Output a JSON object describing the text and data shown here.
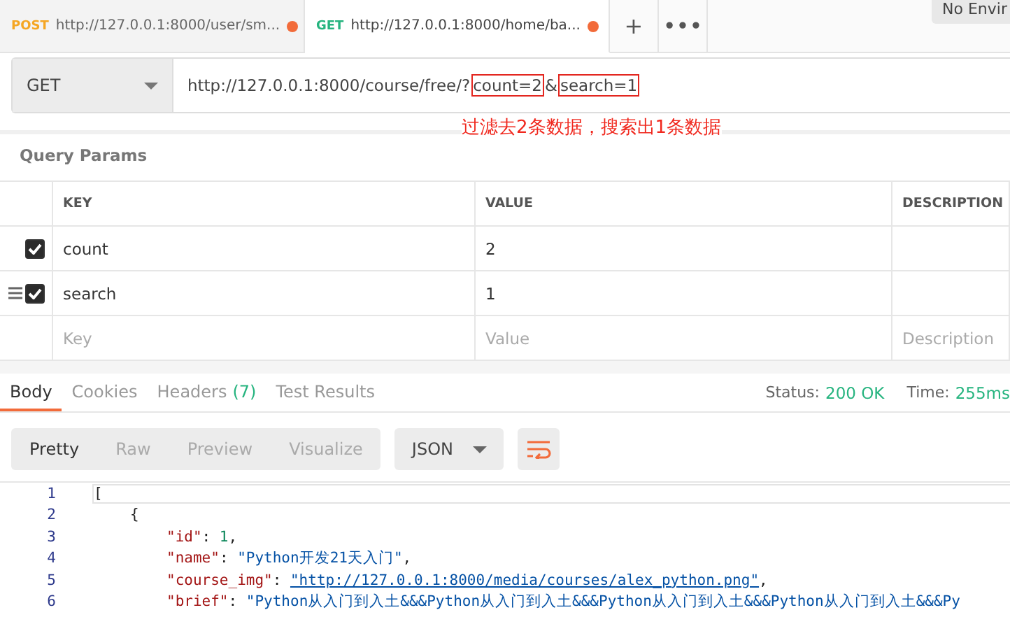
{
  "request_tabs": [
    {
      "method": "POST",
      "kind": "post",
      "label": "http://127.0.0.1:8000/user/sm...",
      "unsaved": true,
      "selected": false
    },
    {
      "method": "GET",
      "kind": "get",
      "label": "http://127.0.0.1:8000/home/ba...",
      "unsaved": true,
      "selected": true
    }
  ],
  "tab_actions": [
    "+",
    "•••"
  ],
  "environment": "No Envir",
  "request": {
    "method": "GET",
    "url_parts": [
      {
        "text": "http://127.0.0.1:8000/course/free/?",
        "boxed": false
      },
      {
        "text": "count=2",
        "boxed": true
      },
      {
        "text": "&",
        "boxed": false
      },
      {
        "text": "search=1",
        "boxed": true
      }
    ],
    "annotation": "过滤去2条数据，搜索出1条数据"
  },
  "query_params": {
    "title": "Query Params",
    "columns": [
      "KEY",
      "VALUE",
      "DESCRIPTION"
    ],
    "rows": [
      {
        "key": "count",
        "value": "2",
        "checked": true,
        "drag_handle": false
      },
      {
        "key": "search",
        "value": "1",
        "checked": true,
        "drag_handle": true
      }
    ],
    "new_row": [
      {
        "placeholder": "Key"
      },
      {
        "placeholder": "Value"
      },
      {
        "placeholder": "Description"
      }
    ]
  },
  "response": {
    "tabs": [
      {
        "label": "Body",
        "selected": true
      },
      {
        "label": "Cookies",
        "selected": false
      },
      {
        "label": "Headers",
        "count": "(7)",
        "selected": false
      },
      {
        "label": "Test Results",
        "selected": false
      }
    ],
    "status_label": "Status:",
    "status": "200 OK",
    "time_label": "Time:",
    "time": "255ms",
    "view_modes": [
      {
        "label": "Pretty",
        "selected": true
      },
      {
        "label": "Raw",
        "selected": false
      },
      {
        "label": "Preview",
        "selected": false
      },
      {
        "label": "Visualize",
        "selected": false
      }
    ],
    "format": "JSON",
    "lines": [
      {
        "number": "1",
        "current": true,
        "tokens": [
          {
            "kind": "punct",
            "text": "["
          }
        ],
        "children": [
          {
            "number": "2",
            "current": false,
            "tokens": [
              {
                "kind": "punct",
                "text": "{"
              }
            ],
            "children": [
              {
                "number": "3",
                "current": false,
                "tokens": [
                  {
                    "kind": "key",
                    "text": "\"id\""
                  },
                  {
                    "kind": "punct",
                    "text": ":"
                  },
                  {
                    "kind": "number",
                    "text": "1"
                  },
                  {
                    "kind": "punct",
                    "text": ","
                  }
                ]
              },
              {
                "number": "4",
                "current": false,
                "tokens": [
                  {
                    "kind": "key",
                    "text": "\"name\""
                  },
                  {
                    "kind": "punct",
                    "text": ":"
                  },
                  {
                    "kind": "string",
                    "text": "\"Python开发21天入门\""
                  },
                  {
                    "kind": "punct",
                    "text": ","
                  }
                ]
              },
              {
                "number": "5",
                "current": false,
                "tokens": [
                  {
                    "kind": "key",
                    "text": "\"course_img\""
                  },
                  {
                    "kind": "punct",
                    "text": ":"
                  },
                  {
                    "kind": "link",
                    "text": "\"http://127.0.0.1:8000/media/courses/alex_python.png\""
                  },
                  {
                    "kind": "punct",
                    "text": ","
                  }
                ]
              },
              {
                "number": "6",
                "current": false,
                "tokens": [
                  {
                    "kind": "key",
                    "text": "\"brief\""
                  },
                  {
                    "kind": "punct",
                    "text": ":"
                  },
                  {
                    "kind": "string",
                    "text": "\"Python从入门到入土&&&Python从入门到入土&&&Python从入门到入土&&&Python从入门到入土&&&Py"
                  }
                ]
              }
            ]
          }
        ]
      }
    ]
  }
}
